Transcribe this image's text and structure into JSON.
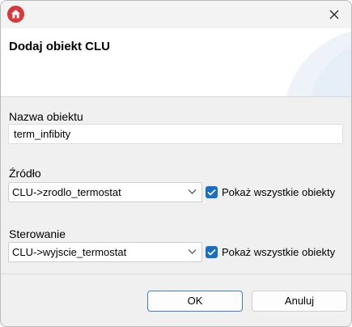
{
  "window": {
    "title": "Dodaj obiekt CLU"
  },
  "titlebar": {
    "app_icon": "home-icon",
    "close_icon": "close-icon"
  },
  "form": {
    "name_label": "Nazwa obiektu",
    "name_value": "term_infibity",
    "source_label": "Źródło",
    "source_value": "CLU->zrodlo_termostat",
    "source_show_all_label": "Pokaż wszystkie obiekty",
    "source_show_all_checked": true,
    "control_label": "Sterowanie",
    "control_value": "CLU->wyjscie_termostat",
    "control_show_all_label": "Pokaż wszystkie obiekty",
    "control_show_all_checked": true
  },
  "buttons": {
    "ok": "OK",
    "cancel": "Anuluj"
  },
  "colors": {
    "accent": "#1a6fc4",
    "icon_red": "#d7383b",
    "ok_border": "#3d7dd6"
  }
}
